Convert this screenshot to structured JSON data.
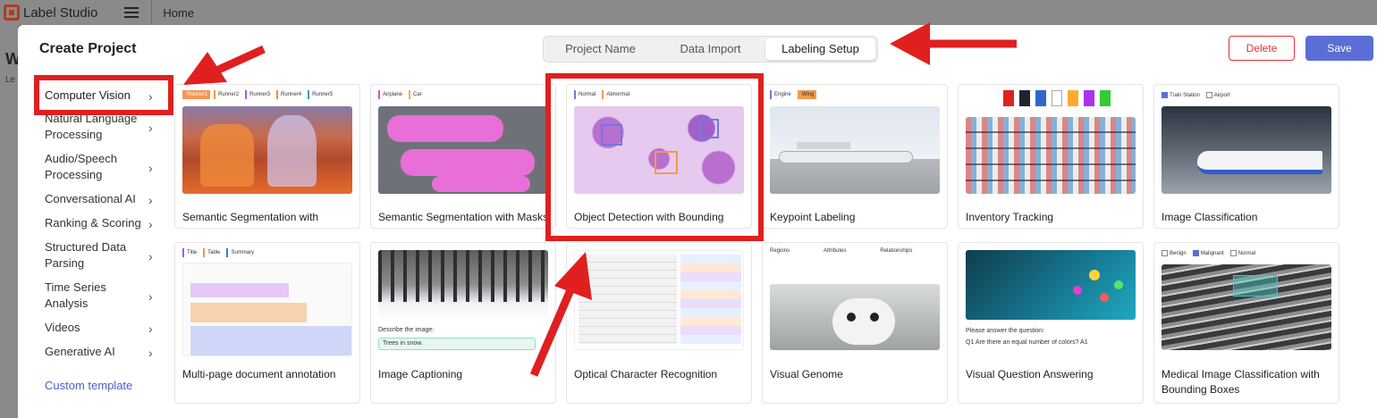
{
  "app": {
    "name": "Label Studio",
    "breadcrumb": "Home",
    "bg_heading": "W",
    "bg_sub": "Le"
  },
  "modal": {
    "title": "Create Project",
    "tabs": [
      {
        "label": "Project Name",
        "active": false
      },
      {
        "label": "Data Import",
        "active": false
      },
      {
        "label": "Labeling Setup",
        "active": true
      }
    ],
    "delete_label": "Delete",
    "save_label": "Save"
  },
  "sidebar": {
    "items": [
      {
        "label": "Computer Vision",
        "active": true
      },
      {
        "label": "Natural Language Processing"
      },
      {
        "label": "Audio/Speech Processing"
      },
      {
        "label": "Conversational AI"
      },
      {
        "label": "Ranking & Scoring"
      },
      {
        "label": "Structured Data Parsing"
      },
      {
        "label": "Time Series Analysis"
      },
      {
        "label": "Videos"
      },
      {
        "label": "Generative AI"
      }
    ],
    "custom_label": "Custom template"
  },
  "templates": [
    {
      "title": "Semantic Segmentation with Polygons",
      "chips": [
        "Runner1",
        "Runner2",
        "Runner3",
        "Runner4",
        "Runner5"
      ]
    },
    {
      "title": "Semantic Segmentation with Masks",
      "chips": [
        "Airplane",
        "Car"
      ]
    },
    {
      "title": "Object Detection with Bounding Boxes",
      "chips": [
        "Normal",
        "Abnormal"
      ]
    },
    {
      "title": "Keypoint Labeling",
      "chips": [
        "Engine",
        "Wing"
      ]
    },
    {
      "title": "Inventory Tracking",
      "chips": []
    },
    {
      "title": "Image Classification",
      "chips": [
        "Train Station",
        "Airport"
      ]
    },
    {
      "title": "Multi-page document annotation",
      "chips": [
        "Title",
        "Table",
        "Summary"
      ]
    },
    {
      "title": "Image Captioning",
      "caption_prompt": "Describe the image:",
      "caption_value": "Trees in snow."
    },
    {
      "title": "Optical Character Recognition"
    },
    {
      "title": "Visual Genome",
      "columns": [
        "Regions",
        "Attributes",
        "Relationships"
      ]
    },
    {
      "title": "Visual Question Answering",
      "question": "Please answer the question:",
      "q1": "Q1   Are there an equal number of colors?   A1"
    },
    {
      "title": "Medical Image Classification with Bounding Boxes",
      "chips": [
        "Benign",
        "Malignant",
        "Normal"
      ]
    }
  ],
  "colors": {
    "highlight": "#e01f1f",
    "accent": "#5b6ed6",
    "delete": "#dd3333"
  }
}
